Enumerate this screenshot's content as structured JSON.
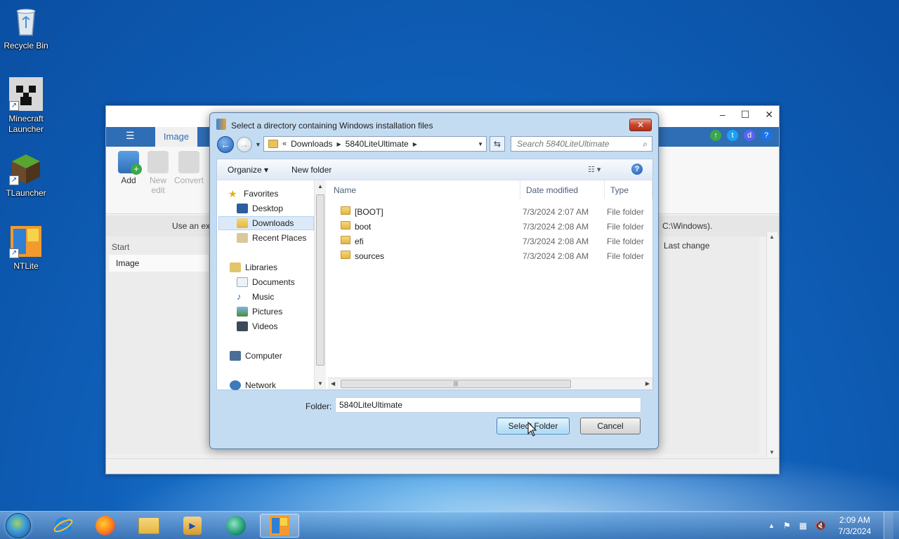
{
  "desktop": {
    "icons": [
      {
        "label": "Recycle Bin"
      },
      {
        "label": "Minecraft Launcher"
      },
      {
        "label": "TLauncher"
      },
      {
        "label": "NTLite"
      }
    ]
  },
  "app": {
    "tab": "Image",
    "ribbon": {
      "add": "Add",
      "new_edit": "New edit",
      "convert": "Convert"
    },
    "info_left": "Use an exi",
    "info_right": "C:\\Windows).",
    "left_pane": {
      "header": "Start",
      "item": "Image"
    },
    "grid_header": "Last change"
  },
  "dialog": {
    "title": "Select a directory containing Windows installation files",
    "address": {
      "prefix": "«",
      "crumbs": [
        "Downloads",
        "5840LiteUltimate"
      ]
    },
    "search_placeholder": "Search 5840LiteUltimate",
    "toolbar": {
      "organize": "Organize ▾",
      "new_folder": "New folder"
    },
    "nav": {
      "favorites": "Favorites",
      "desktop": "Desktop",
      "downloads": "Downloads",
      "recent_places": "Recent Places",
      "libraries": "Libraries",
      "documents": "Documents",
      "music": "Music",
      "pictures": "Pictures",
      "videos": "Videos",
      "computer": "Computer",
      "network": "Network"
    },
    "columns": {
      "name": "Name",
      "date": "Date modified",
      "type": "Type"
    },
    "files": [
      {
        "name": "[BOOT]",
        "date": "7/3/2024 2:07 AM",
        "type": "File folder"
      },
      {
        "name": "boot",
        "date": "7/3/2024 2:08 AM",
        "type": "File folder"
      },
      {
        "name": "efi",
        "date": "7/3/2024 2:08 AM",
        "type": "File folder"
      },
      {
        "name": "sources",
        "date": "7/3/2024 2:08 AM",
        "type": "File folder"
      }
    ],
    "folder_label": "Folder:",
    "folder_value": "5840LiteUltimate",
    "select_button": "Select Folder",
    "cancel_button": "Cancel"
  },
  "taskbar": {
    "time": "2:09 AM",
    "date": "7/3/2024"
  }
}
